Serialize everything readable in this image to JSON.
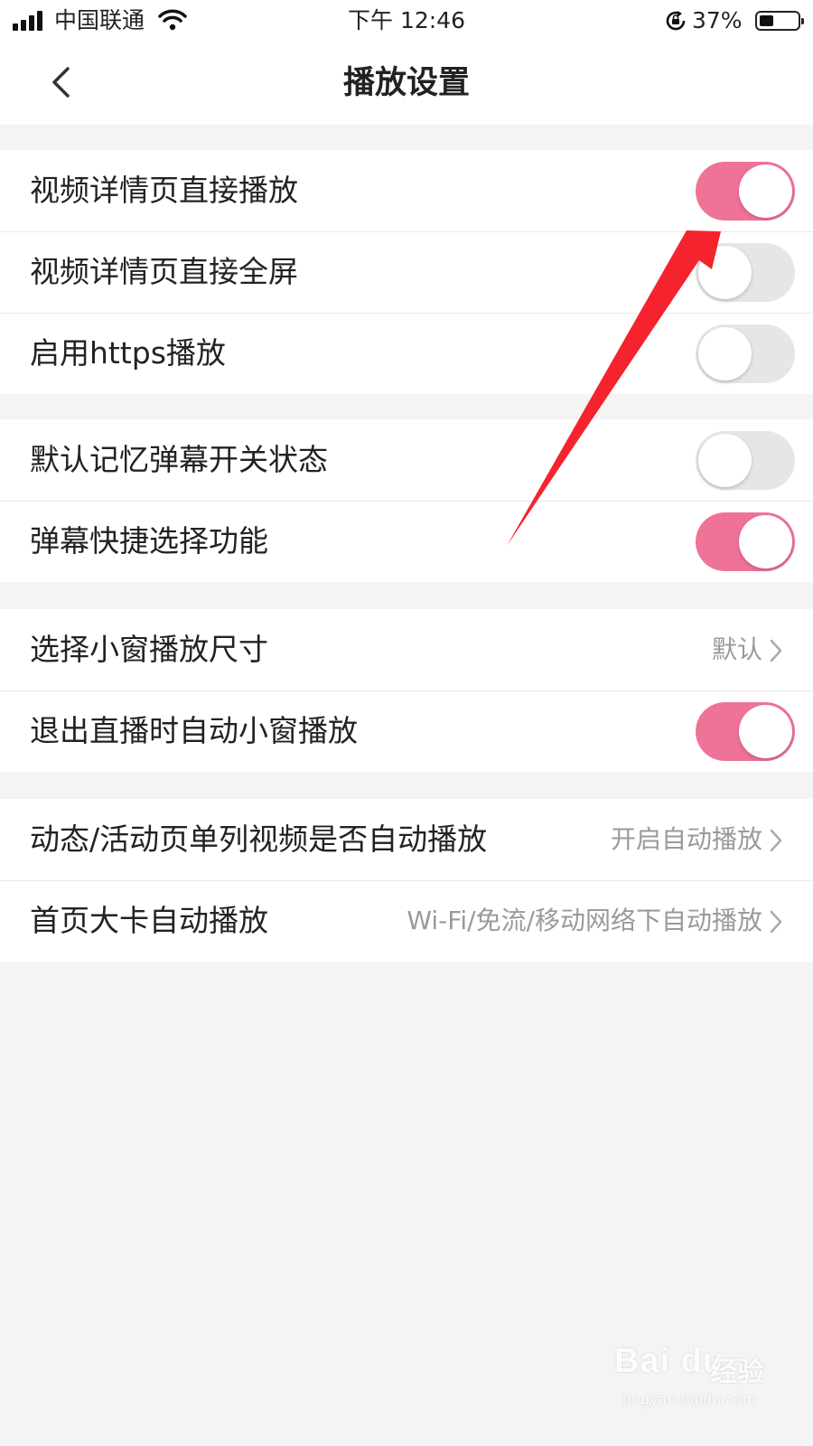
{
  "status_bar": {
    "carrier": "中国联通",
    "time": "下午 12:46",
    "battery_percent": "37%",
    "battery_level": 0.37
  },
  "nav": {
    "title": "播放设置",
    "back_icon": "chevron-left-icon"
  },
  "sections": [
    {
      "items": [
        {
          "label": "视频详情页直接播放",
          "type": "toggle",
          "on": true
        },
        {
          "label": "视频详情页直接全屏",
          "type": "toggle",
          "on": false
        },
        {
          "label": "启用https播放",
          "type": "toggle",
          "on": false
        }
      ]
    },
    {
      "items": [
        {
          "label": "默认记忆弹幕开关状态",
          "type": "toggle",
          "on": false
        },
        {
          "label": "弹幕快捷选择功能",
          "type": "toggle",
          "on": true
        }
      ]
    },
    {
      "items": [
        {
          "label": "选择小窗播放尺寸",
          "type": "link",
          "value": "默认"
        },
        {
          "label": "退出直播时自动小窗播放",
          "type": "toggle",
          "on": true
        }
      ]
    },
    {
      "items": [
        {
          "label": "动态/活动页单列视频是否自动播放",
          "type": "link",
          "value": "开启自动播放"
        },
        {
          "label": "首页大卡自动播放",
          "type": "link",
          "value": "Wi-Fi/免流/移动网络下自动播放"
        }
      ]
    }
  ],
  "colors": {
    "toggle_on": "#ef7396",
    "toggle_off": "#e6e6e6",
    "annotation_arrow": "#f5232e"
  },
  "watermark": {
    "logo": "Bai du",
    "text": "经验",
    "url": "jingyan.baidu.com"
  }
}
